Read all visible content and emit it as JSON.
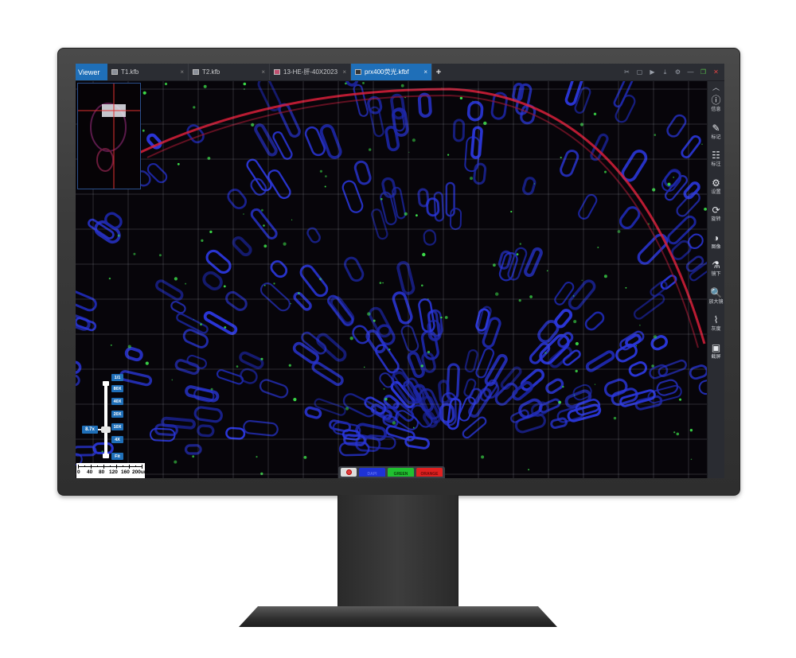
{
  "app": {
    "viewer_tab": "Viewer",
    "tabs": [
      {
        "label": "T1.kfb",
        "close": "×",
        "active": false
      },
      {
        "label": "T2.kfb",
        "close": "×",
        "active": false
      },
      {
        "label": "13-HE-肝-40X2023",
        "close": "×",
        "active": false
      },
      {
        "label": "prx400荧光.kfbf",
        "close": "×",
        "active": true
      }
    ],
    "add_tab": "+",
    "window_controls": {
      "cut": "✂",
      "save": "▢",
      "play": "▶",
      "download": "⤓",
      "settings": "⚙",
      "minimize": "—",
      "restore": "❐",
      "close": "✕"
    }
  },
  "toolbar": {
    "collapse": "︿",
    "items": [
      {
        "icon": "ⓘ",
        "label": "信息"
      },
      {
        "icon": "✎",
        "label": "标记"
      },
      {
        "icon": "☷",
        "label": "标注"
      },
      {
        "icon": "⚙",
        "label": "设置"
      },
      {
        "icon": "⟳",
        "label": "旋转"
      },
      {
        "icon": "◑",
        "label": "图像"
      },
      {
        "icon": "⚗",
        "label": "镜下"
      },
      {
        "icon": "🔍",
        "label": "放大镜"
      },
      {
        "icon": "⌇",
        "label": "灰度"
      },
      {
        "icon": "▣",
        "label": "截屏"
      }
    ]
  },
  "zoom": {
    "presets": [
      "1/1",
      "80X",
      "40X",
      "20X",
      "10X",
      "4X",
      "Fit"
    ],
    "current": "8.7x"
  },
  "scalebar": {
    "labels": [
      "0",
      "40",
      "80",
      "120",
      "160",
      "200um"
    ]
  },
  "channels": [
    {
      "label": "DAPI",
      "color": "#1e32d6"
    },
    {
      "label": "GREEN",
      "color": "#20c030"
    },
    {
      "label": "ORANGE",
      "color": "#e02020"
    }
  ]
}
